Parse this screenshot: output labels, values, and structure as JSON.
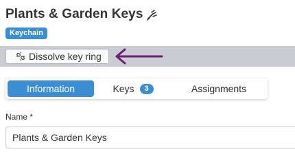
{
  "header": {
    "title": "Plants & Garden Keys",
    "title_icon": "unlinked-key-icon",
    "type_badge": "Keychain"
  },
  "toolbar": {
    "dissolve_label": "Dissolve key ring",
    "dissolve_icon": "unlink-icon",
    "arrow_color": "#6b1f72"
  },
  "tabs": [
    {
      "label": "Information",
      "active": true
    },
    {
      "label": "Keys",
      "count": "3",
      "active": false
    },
    {
      "label": "Assignments",
      "active": false
    }
  ],
  "form": {
    "name_label": "Name *",
    "name_value": "Plants & Garden Keys"
  },
  "colors": {
    "accent": "#3b8ed4",
    "toolbar_bg": "#c9cdd3"
  }
}
